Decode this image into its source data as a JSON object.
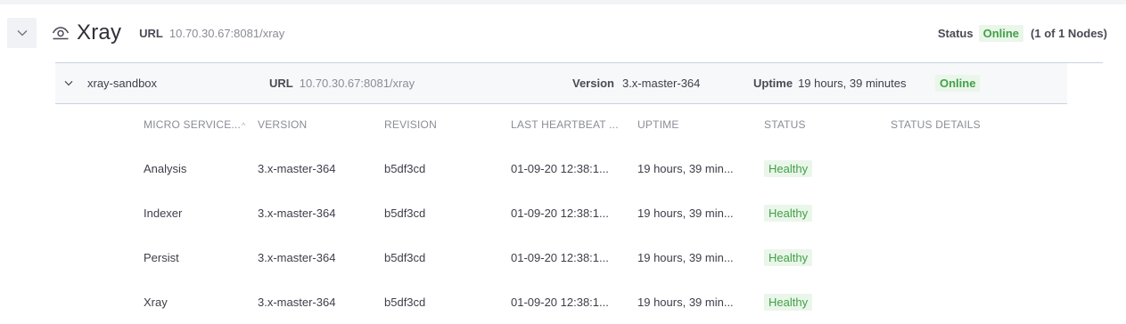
{
  "service": {
    "title": "Xray",
    "url_label": "URL",
    "url": "10.70.30.67:8081/xray",
    "status_label": "Status",
    "status": "Online",
    "nodes_count": "(1 of 1 Nodes)"
  },
  "node": {
    "name": "xray-sandbox",
    "url_label": "URL",
    "url": "10.70.30.67:8081/xray",
    "version_label": "Version",
    "version": "3.x-master-364",
    "uptime_label": "Uptime",
    "uptime": "19 hours, 39 minutes",
    "status": "Online"
  },
  "table": {
    "headers": [
      "MICRO SERVICE...",
      "VERSION",
      "REVISION",
      "LAST HEARTBEAT ...",
      "UPTIME",
      "STATUS",
      "STATUS DETAILS"
    ],
    "rows": [
      {
        "name": "Analysis",
        "version": "3.x-master-364",
        "revision": "b5df3cd",
        "heartbeat": "01-09-20 12:38:1...",
        "uptime": "19 hours, 39 min...",
        "status": "Healthy",
        "details": ""
      },
      {
        "name": "Indexer",
        "version": "3.x-master-364",
        "revision": "b5df3cd",
        "heartbeat": "01-09-20 12:38:1...",
        "uptime": "19 hours, 39 min...",
        "status": "Healthy",
        "details": ""
      },
      {
        "name": "Persist",
        "version": "3.x-master-364",
        "revision": "b5df3cd",
        "heartbeat": "01-09-20 12:38:1...",
        "uptime": "19 hours, 39 min...",
        "status": "Healthy",
        "details": ""
      },
      {
        "name": "Xray",
        "version": "3.x-master-364",
        "revision": "b5df3cd",
        "heartbeat": "01-09-20 12:38:1...",
        "uptime": "19 hours, 39 min...",
        "status": "Healthy",
        "details": ""
      }
    ]
  },
  "colors": {
    "healthy": "#43a047",
    "healthy_bg": "#eaf6ea"
  },
  "icons": {
    "collapse": "chevron-down-icon",
    "service": "eye-icon",
    "node": "chevron-down-icon"
  }
}
